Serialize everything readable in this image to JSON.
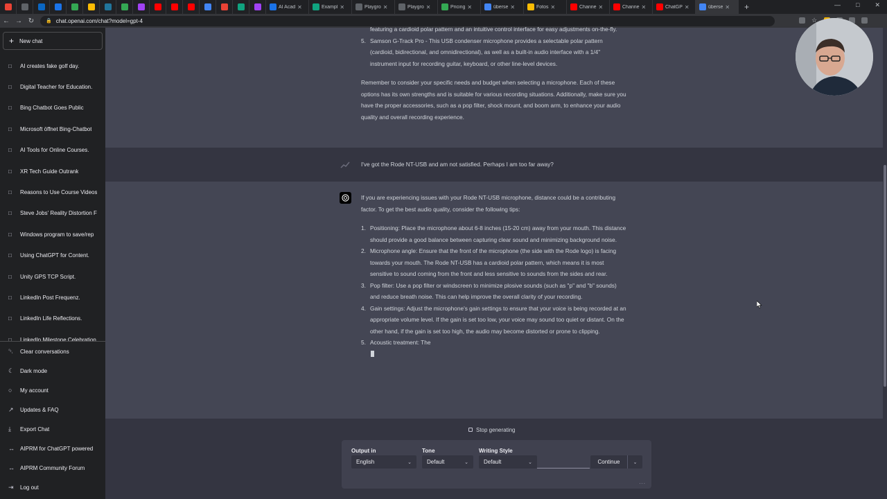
{
  "browser": {
    "tabs": [
      {
        "title": "",
        "color": "#ea4335"
      },
      {
        "title": "",
        "color": "#5f6368"
      },
      {
        "title": "",
        "color": "#0a66c2"
      },
      {
        "title": "",
        "color": "#1a73e8"
      },
      {
        "title": "",
        "color": "#34a853"
      },
      {
        "title": "",
        "color": "#fbbc04"
      },
      {
        "title": "",
        "color": "#21759b"
      },
      {
        "title": "",
        "color": "#34a853"
      },
      {
        "title": "",
        "color": "#a142f4"
      },
      {
        "title": "",
        "color": "#ff0000"
      },
      {
        "title": "",
        "color": "#ff0000"
      },
      {
        "title": "",
        "color": "#ff0000"
      },
      {
        "title": "",
        "color": "#4285f4"
      },
      {
        "title": "",
        "color": "#ea4335"
      },
      {
        "title": "",
        "color": "#10a37f"
      },
      {
        "title": "",
        "color": "#a142f4"
      },
      {
        "title": "AI Acad",
        "color": "#1a73e8"
      },
      {
        "title": "Exampl",
        "color": "#10a37f"
      },
      {
        "title": "Playgro",
        "color": "#5f6368"
      },
      {
        "title": "Playgro",
        "color": "#5f6368"
      },
      {
        "title": "Pricing",
        "color": "#34a853"
      },
      {
        "title": "überse",
        "color": "#4285f4"
      },
      {
        "title": "Fotos",
        "color": "#fbbc04"
      },
      {
        "title": "Channe",
        "color": "#ff0000"
      },
      {
        "title": "Channe",
        "color": "#ff0000"
      },
      {
        "title": "ChatGP",
        "color": "#ff0000"
      },
      {
        "title": "überse",
        "color": "#4285f4"
      }
    ],
    "url": "chat.openai.com/chat?model=gpt-4"
  },
  "sidebar": {
    "new_chat": "New chat",
    "conversations": [
      "AI creates fake golf day.",
      "Digital Teacher for Education.",
      "Bing Chatbot Goes Public",
      "Microsoft öffnet Bing-Chatbot",
      "AI Tools for Online Courses.",
      "XR Tech Guide Outrank",
      "Reasons to Use Course Videos",
      "Steve Jobs' Reality Distortion F",
      "Windows program to save/rep",
      "Using ChatGPT for Content.",
      "Unity GPS TCP Script.",
      "LinkedIn Post Frequenz.",
      "LinkedIn Life Reflections.",
      "LinkedIn Milestone Celebration"
    ],
    "menu": [
      {
        "label": "Clear conversations",
        "icon": "trash-icon"
      },
      {
        "label": "Dark mode",
        "icon": "moon-icon"
      },
      {
        "label": "My account",
        "icon": "user-icon"
      },
      {
        "label": "Updates & FAQ",
        "icon": "external-link-icon"
      },
      {
        "label": "Export Chat",
        "icon": "download-icon"
      },
      {
        "label": "AIPRM for ChatGPT powered",
        "icon": "link-icon"
      },
      {
        "label": "AIPRM Community Forum",
        "icon": "link-icon"
      },
      {
        "label": "Log out",
        "icon": "logout-icon"
      }
    ]
  },
  "messages": {
    "prev_assistant": {
      "item4_tail": "featuring a cardioid polar pattern and an intuitive control interface for easy adjustments on-the-fly.",
      "item5_num": "5.",
      "item5": "Samson G-Track Pro - This USB condenser microphone provides a selectable polar pattern (cardioid, bidirectional, and omnidirectional), as well as a built-in audio interface with a 1/4\" instrument input for recording guitar, keyboard, or other line-level devices.",
      "closing": "Remember to consider your specific needs and budget when selecting a microphone. Each of these options has its own strengths and is suitable for various recording situations. Additionally, make sure you have the proper accessories, such as a pop filter, shock mount, and boom arm, to enhance your audio quality and overall recording experience."
    },
    "user": "I've got the Rode NT-USB and am not satisfied. Perhaps I am too far away?",
    "assistant": {
      "intro": "If you are experiencing issues with your Rode NT-USB microphone, distance could be a contributing factor. To get the best audio quality, consider the following tips:",
      "items": [
        {
          "num": "1.",
          "text": "Positioning: Place the microphone about 6-8 inches (15-20 cm) away from your mouth. This distance should provide a good balance between capturing clear sound and minimizing background noise."
        },
        {
          "num": "2.",
          "text": "Microphone angle: Ensure that the front of the microphone (the side with the Rode logo) is facing towards your mouth. The Rode NT-USB has a cardioid polar pattern, which means it is most sensitive to sound coming from the front and less sensitive to sounds from the sides and rear."
        },
        {
          "num": "3.",
          "text": "Pop filter: Use a pop filter or windscreen to minimize plosive sounds (such as \"p\" and \"b\" sounds) and reduce breath noise. This can help improve the overall clarity of your recording."
        },
        {
          "num": "4.",
          "text": "Gain settings: Adjust the microphone's gain settings to ensure that your voice is being recorded at an appropriate volume level. If the gain is set too low, your voice may sound too quiet or distant. On the other hand, if the gain is set too high, the audio may become distorted or prone to clipping."
        },
        {
          "num": "5.",
          "text": "Acoustic treatment: The"
        }
      ]
    }
  },
  "controls": {
    "stop": "Stop generating",
    "output_label": "Output in",
    "output_value": "English",
    "tone_label": "Tone",
    "tone_value": "Default",
    "style_label": "Writing Style",
    "style_value": "Default",
    "continue": "Continue",
    "dots": "..."
  },
  "colors": {
    "sidebar_bg": "#202123",
    "main_bg": "#343541",
    "assistant_row_bg": "#444654",
    "assistant_avatar": "#000000"
  }
}
